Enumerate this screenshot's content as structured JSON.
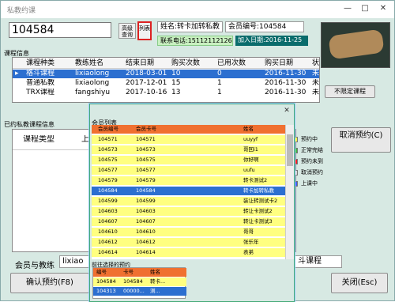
{
  "window": {
    "title": "私教约课",
    "min": "—",
    "max": "□",
    "close": "✕"
  },
  "search": {
    "value": "104584",
    "lookup_label": "高级查询",
    "list_label": "列表"
  },
  "member": {
    "name_label": "姓名:转卡加转私教",
    "id_label": "会员编号:104584",
    "phone_label": "联系电话:15112112126",
    "join_label": "加入日期:2016-11-25"
  },
  "course_info": {
    "section_label": "课程信息",
    "headers": [
      "课程种类",
      "教练姓名",
      "结束日期",
      "购买次数",
      "已用次数",
      "购买日期",
      "状"
    ],
    "rows": [
      [
        "格斗课程",
        "lixiaolong",
        "2018-03-01",
        "10",
        "0",
        "2016-11-30",
        "未"
      ],
      [
        "普通私教",
        "lixiaolong",
        "2017-12-01",
        "15",
        "1",
        "2016-11-30",
        "未"
      ],
      [
        "TRX课程",
        "fangshiyu",
        "2017-10-16",
        "13",
        "1",
        "2016-11-30",
        "未"
      ]
    ],
    "unlimited_button": "不限定课程"
  },
  "booked": {
    "section_label": "已约私教课程信息",
    "headers": [
      "课程类型",
      "上课"
    ],
    "cancel_button": "取消预约(C)"
  },
  "legend": [
    {
      "label": "预约中",
      "color": "#ffff40"
    },
    {
      "label": "正常完结",
      "color": "#40c040"
    },
    {
      "label": "预约未到",
      "color": "#ff2020"
    },
    {
      "label": "取消预约",
      "color": "#d8d8d8"
    },
    {
      "label": "上课中",
      "color": "#4060ff"
    }
  ],
  "member_list_popup": {
    "title": "会员列表",
    "headers": [
      "会员编号",
      "会员卡号",
      "姓名"
    ],
    "rows": [
      [
        "104571",
        "104571",
        "uuyyf"
      ],
      [
        "104573",
        "104573",
        "哥回i1"
      ],
      [
        "104575",
        "104575",
        "你好啊"
      ],
      [
        "104577",
        "104577",
        "uufu"
      ],
      [
        "104579",
        "104579",
        "转卡测试2"
      ],
      [
        "104584",
        "104584",
        "转卡加转私教"
      ],
      [
        "104599",
        "104599",
        "装让转测试卡2"
      ],
      [
        "104603",
        "104603",
        "转让卡测试2"
      ],
      [
        "104607",
        "104607",
        "转让卡测试3"
      ],
      [
        "104610",
        "104610",
        "哥哥"
      ],
      [
        "104612",
        "104612",
        "张乐年"
      ],
      [
        "104614",
        "104614",
        "表弟"
      ]
    ],
    "selected_index": 5,
    "selected_label": "前往选择的预约",
    "sub_headers": [
      "编号",
      "卡号",
      "姓名"
    ],
    "sub_rows": [
      [
        "104584",
        "104584",
        "转卡..."
      ],
      [
        "104313",
        "00000...",
        "测..."
      ]
    ]
  },
  "footer": {
    "coach_label": "会员与教练",
    "coach_value": "lixiao",
    "course_value": "斗课程",
    "confirm_button": "确认预约(F8)",
    "close_button": "关闭(Esc)"
  }
}
